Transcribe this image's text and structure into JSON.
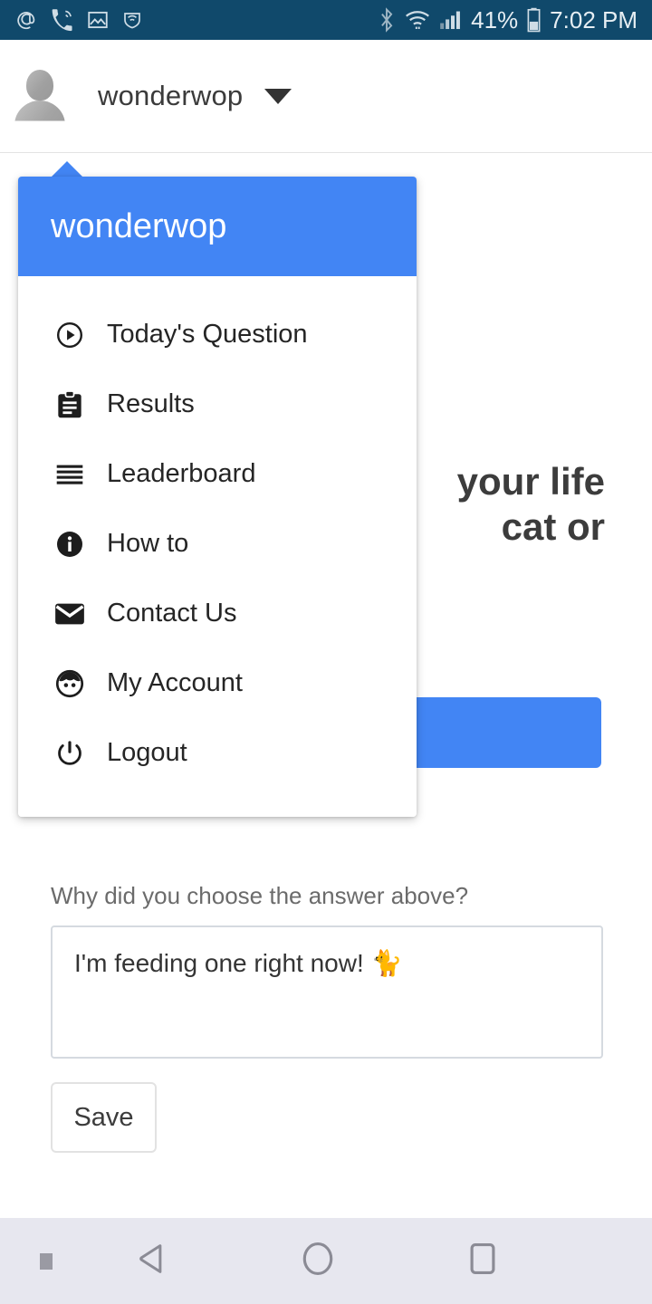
{
  "status_bar": {
    "background": "#10496B",
    "left_icons": [
      "at-sign-icon",
      "phone-ringing-icon",
      "image-icon",
      "vpn-shield-icon"
    ],
    "right_icons": [
      "bluetooth-icon",
      "wifi-icon",
      "cellular-signal-icon",
      "battery-icon"
    ],
    "battery_percent": "41%",
    "time": "7:02 PM"
  },
  "header": {
    "username": "wonderwop",
    "avatar_icon": "default-user-avatar",
    "dropdown_icon": "caret-down-icon"
  },
  "menu": {
    "accent_color": "#4285F4",
    "title": "wonderwop",
    "items": [
      {
        "label": "Today's Question",
        "icon": "play-circle-icon"
      },
      {
        "label": "Results",
        "icon": "clipboard-icon"
      },
      {
        "label": "Leaderboard",
        "icon": "list-lines-icon"
      },
      {
        "label": "How to",
        "icon": "info-circle-icon"
      },
      {
        "label": "Contact Us",
        "icon": "envelope-icon"
      },
      {
        "label": "My Account",
        "icon": "account-face-icon"
      },
      {
        "label": "Logout",
        "icon": "power-icon"
      }
    ]
  },
  "main": {
    "question_lines": [
      "your life",
      "cat or"
    ],
    "answer_button_color": "#4285F4",
    "reason_label": "Why did you choose the answer above?",
    "reason_value": "I'm feeding one right now! 🐈",
    "reason_placeholder": "",
    "save_label": "Save"
  },
  "nav_bar": {
    "background": "#E7E7EF",
    "buttons": [
      "menu-dot-icon",
      "back-triangle-icon",
      "home-circle-icon",
      "recents-square-icon"
    ]
  }
}
